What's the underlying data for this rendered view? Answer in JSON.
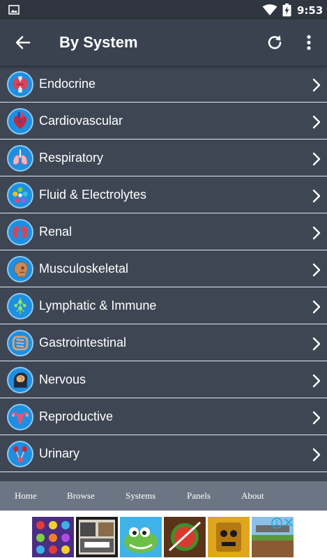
{
  "status_bar": {
    "time": "9:53",
    "icons": [
      "gallery-notification-icon",
      "wifi-icon",
      "battery-charging-icon"
    ]
  },
  "app_bar": {
    "title": "By System",
    "actions": [
      "back-arrow-icon",
      "refresh-icon",
      "more-vert-icon"
    ]
  },
  "systems": [
    {
      "label": "Endocrine",
      "icon": "thyroid-icon"
    },
    {
      "label": "Cardiovascular",
      "icon": "heart-icon"
    },
    {
      "label": "Respiratory",
      "icon": "lungs-icon"
    },
    {
      "label": "Fluid & Electrolytes",
      "icon": "electrolytes-icon"
    },
    {
      "label": "Renal",
      "icon": "kidneys-icon"
    },
    {
      "label": "Musculoskeletal",
      "icon": "skull-icon"
    },
    {
      "label": "Lymphatic & Immune",
      "icon": "lymphatic-icon"
    },
    {
      "label": "Gastrointestinal",
      "icon": "intestines-icon"
    },
    {
      "label": "Nervous",
      "icon": "brain-icon"
    },
    {
      "label": "Reproductive",
      "icon": "uterus-icon"
    },
    {
      "label": "Urinary",
      "icon": "urinary-tract-icon"
    }
  ],
  "bottom_nav": {
    "tabs": [
      "Home",
      "Browse",
      "Systems",
      "Panels",
      "About"
    ]
  },
  "ad_banner": {
    "tiles": [
      "candy-game-icon",
      "gta-game-icon",
      "crocodile-game-icon",
      "fruit-ninja-game-icon",
      "temple-run-game-icon",
      "minecraft-game-icon"
    ],
    "colors": {
      "info": "#1ea7e1",
      "disc": "#1e8fe0",
      "bar": "#3a4250",
      "nav": "#6b7583"
    }
  }
}
